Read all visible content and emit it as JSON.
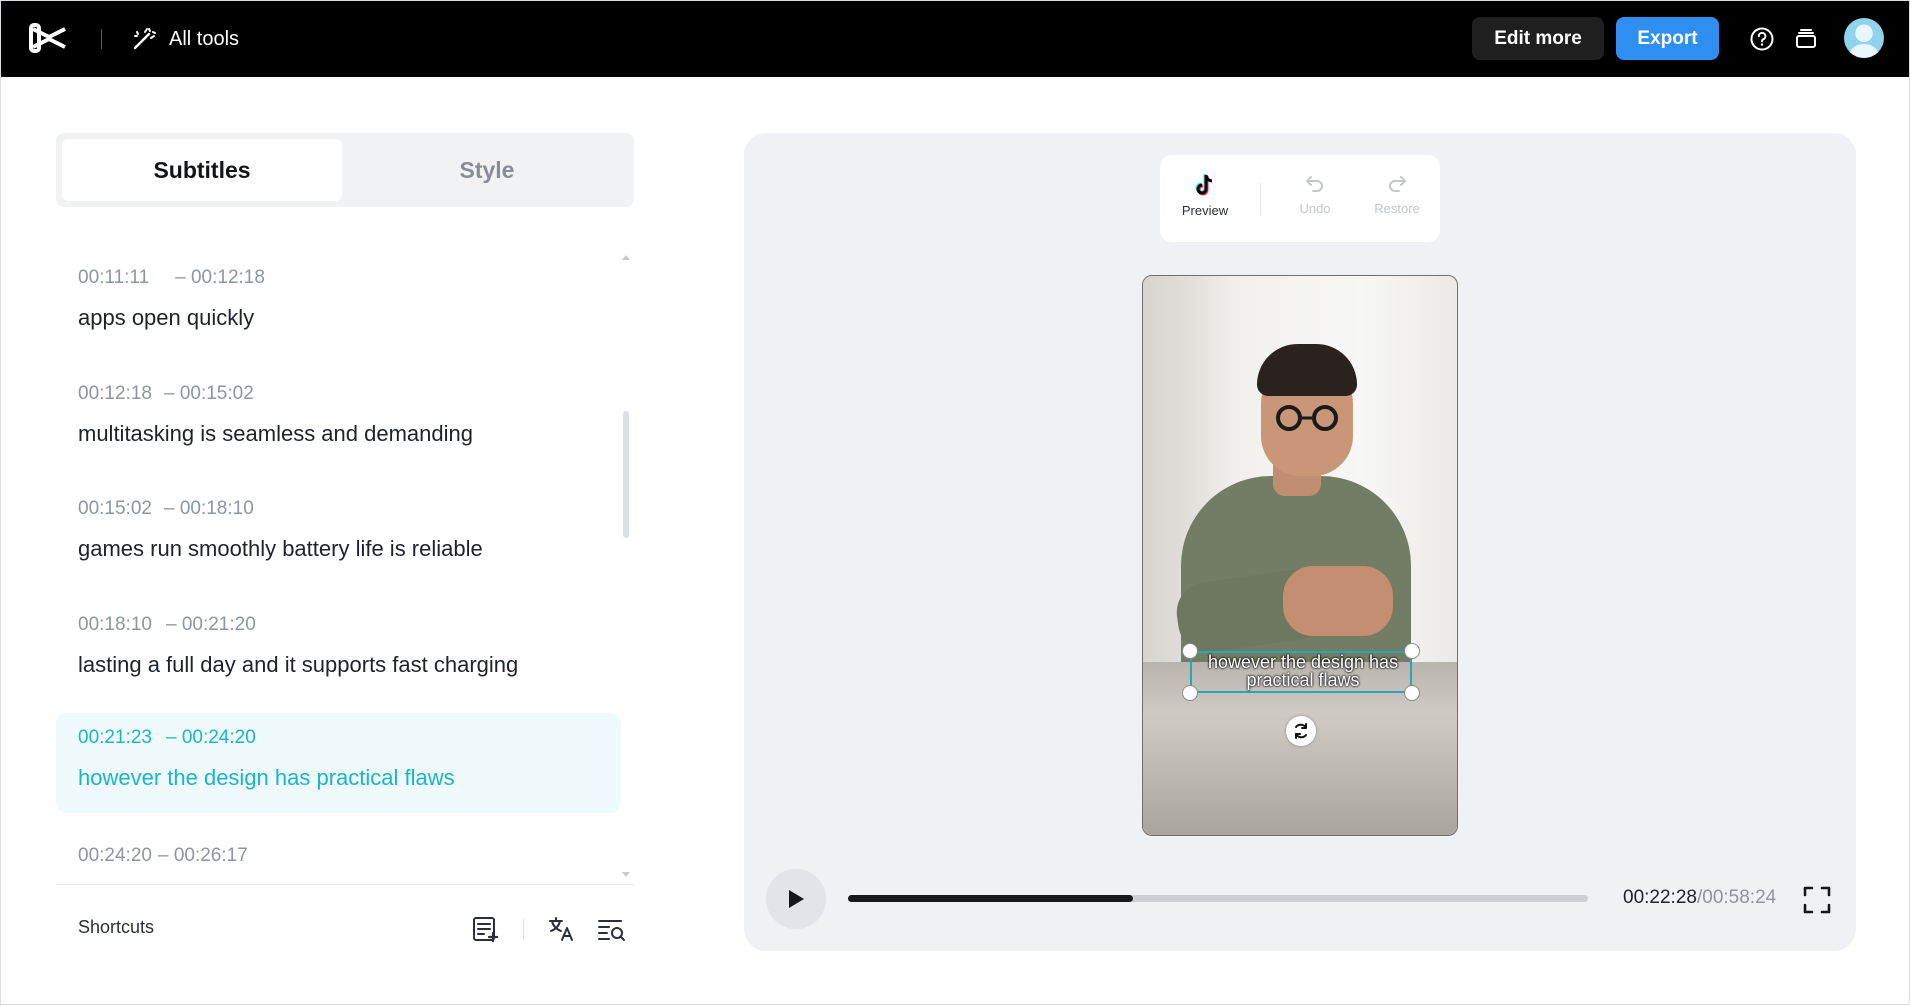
{
  "topbar": {
    "logo_icon": "capcut-logo-icon",
    "all_tools_label": "All tools",
    "edit_more_label": "Edit more",
    "export_label": "Export",
    "export_color": "#2e8ff0"
  },
  "left": {
    "tabs": [
      {
        "label": "Subtitles",
        "active": true
      },
      {
        "label": "Style",
        "active": false
      }
    ],
    "subtitles": [
      {
        "start": "00:11:11",
        "end": "– 00:12:18",
        "text": "apps open quickly"
      },
      {
        "start": "00:12:18",
        "end": "– 00:15:02",
        "text": "multitasking is seamless and demanding"
      },
      {
        "start": "00:15:02",
        "end": "– 00:18:10",
        "text": "games run smoothly battery life is reliable"
      },
      {
        "start": "00:18:10",
        "end": "– 00:21:20",
        "text": "lasting a full day and it supports fast charging"
      },
      {
        "start": "00:21:23",
        "end": "– 00:24:20",
        "text": "however the design has practical flaws",
        "active": true
      },
      {
        "start": "00:24:20",
        "end": "– 00:26:17",
        "text": ""
      }
    ],
    "active_color": "#1bb5cb",
    "shortcuts_label": "Shortcuts"
  },
  "player": {
    "toolbar": {
      "preview_label": "Preview",
      "undo_label": "Undo",
      "restore_label": "Restore"
    },
    "subtitle_overlay_line1": "however the design has",
    "subtitle_overlay_line2": "practical flaws",
    "current_time": "00:22:28",
    "total_time": "/00:58:24",
    "progress": 0.385
  }
}
